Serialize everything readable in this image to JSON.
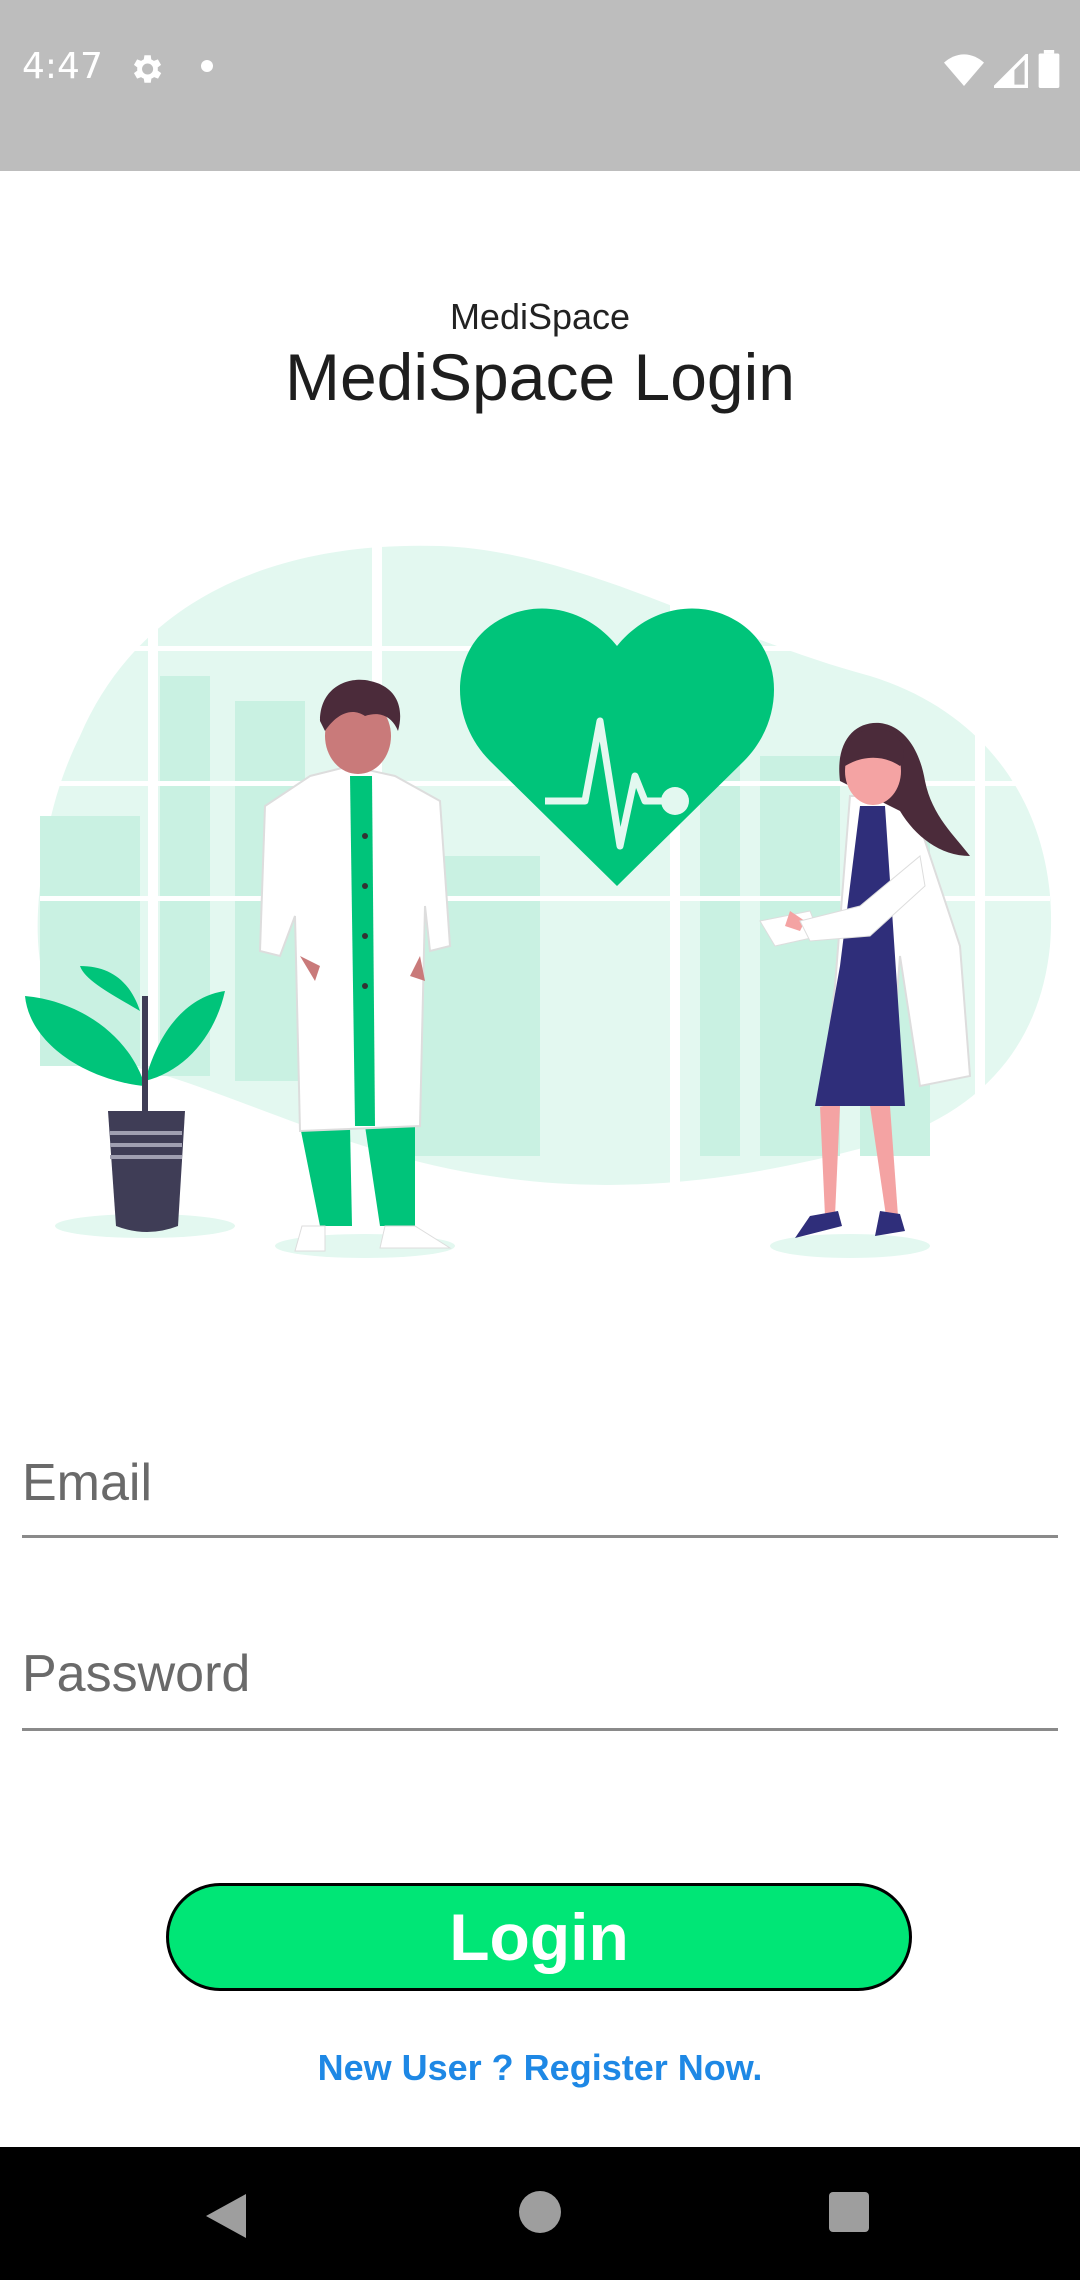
{
  "status_bar": {
    "time": "4:47",
    "icons": [
      "gear-icon",
      "notification-dot-icon",
      "wifi-icon",
      "signal-icon",
      "battery-icon"
    ]
  },
  "header": {
    "app_name": "MediSpace",
    "title": "MediSpace Login"
  },
  "illustration": {
    "description_icon": "doctors-heart-illustration"
  },
  "form": {
    "email_placeholder": "Email",
    "email_value": "",
    "password_placeholder": "Password",
    "password_value": ""
  },
  "actions": {
    "login_label": "Login",
    "register_label": "New User ? Register Now."
  },
  "nav_bar": {
    "icons": [
      "back-icon",
      "home-icon",
      "recents-icon"
    ]
  },
  "colors": {
    "accent": "#00e676",
    "link": "#1e88e5",
    "illustration_green": "#00c47a",
    "illustration_light": "#d9f5eb"
  }
}
